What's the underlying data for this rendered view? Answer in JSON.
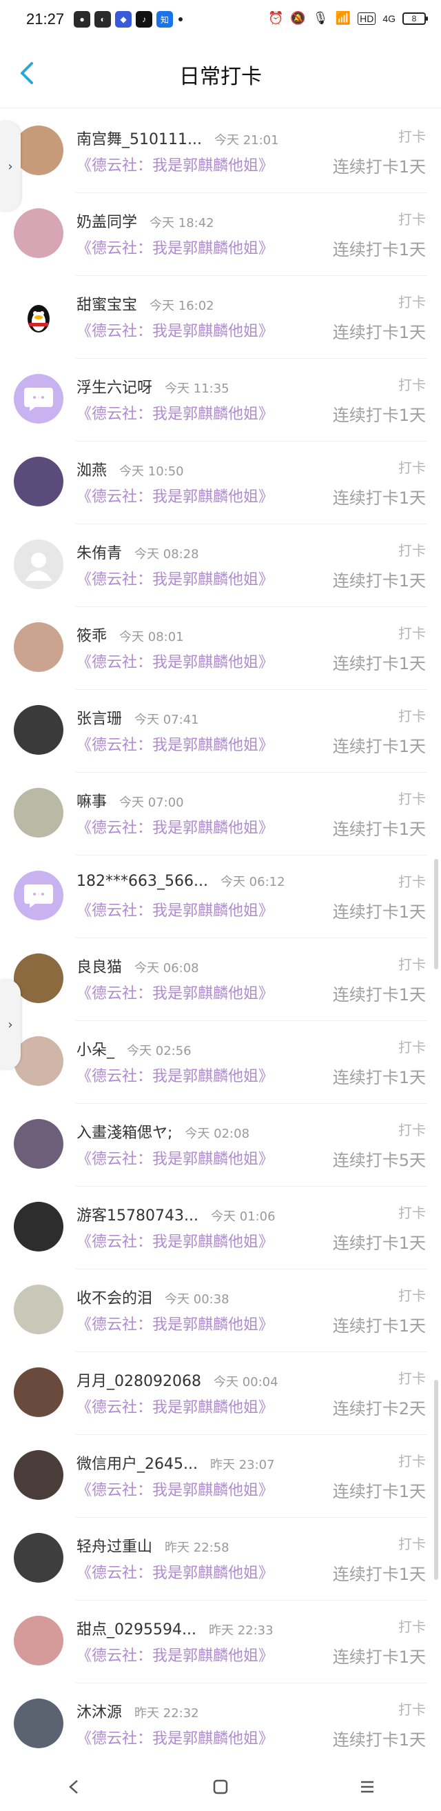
{
  "status_bar": {
    "time": "21:27",
    "battery": "8",
    "hd": "HD",
    "signal": "4G"
  },
  "header": {
    "title": "日常打卡"
  },
  "checkin_label": "打卡",
  "book": "《德云社：我是郭麒麟他姐》",
  "rows": [
    {
      "name": "南宫舞_510111...",
      "time": "今天 21:01",
      "streak": "连续打卡1天",
      "avatar": "anime-girl-avatar",
      "color": "#c79b7a"
    },
    {
      "name": "奶盖同学",
      "time": "今天 18:42",
      "streak": "连续打卡1天",
      "avatar": "anime-girl-avatar",
      "color": "#d7a6b5"
    },
    {
      "name": "甜蜜宝宝",
      "time": "今天 16:02",
      "streak": "连续打卡1天",
      "avatar": "penguin-avatar",
      "color": "#ffffff"
    },
    {
      "name": "浮生六记呀",
      "time": "今天 11:35",
      "streak": "连续打卡1天",
      "avatar": "default-chat-avatar",
      "color": "#c9b2f0"
    },
    {
      "name": "洳燕",
      "time": "今天 10:50",
      "streak": "连续打卡1天",
      "avatar": "night-scene-avatar",
      "color": "#5a4b7a"
    },
    {
      "name": "朱侑青",
      "time": "今天 08:28",
      "streak": "连续打卡1天",
      "avatar": "default-user-avatar",
      "color": "#e7e7e7"
    },
    {
      "name": "筱乖",
      "time": "今天 08:01",
      "streak": "连续打卡1天",
      "avatar": "photo-avatar",
      "color": "#caa48e"
    },
    {
      "name": "张言珊",
      "time": "今天 07:41",
      "streak": "连续打卡1天",
      "avatar": "photo-avatar",
      "color": "#3a3a3a"
    },
    {
      "name": "嘛事",
      "time": "今天 07:00",
      "streak": "连续打卡1天",
      "avatar": "cat-avatar",
      "color": "#b9b9a6"
    },
    {
      "name": "182***663_566...",
      "time": "今天 06:12",
      "streak": "连续打卡1天",
      "avatar": "default-chat-avatar",
      "color": "#c9b2f0"
    },
    {
      "name": "良良猫",
      "time": "今天 06:08",
      "streak": "连续打卡1天",
      "avatar": "photo-avatar",
      "color": "#8a6a3e"
    },
    {
      "name": "小朵_",
      "time": "今天 02:56",
      "streak": "连续打卡1天",
      "avatar": "photo-avatar",
      "color": "#d0b6a9"
    },
    {
      "name": "入畫淺箱偲ヤ;",
      "time": "今天 02:08",
      "streak": "连续打卡5天",
      "avatar": "photo-avatar",
      "color": "#6d5e7a"
    },
    {
      "name": "游客15780743...",
      "time": "今天 01:06",
      "streak": "连续打卡1天",
      "avatar": "photo-avatar",
      "color": "#2d2d2d"
    },
    {
      "name": "收不会的泪",
      "time": "今天 00:38",
      "streak": "连续打卡1天",
      "avatar": "photo-avatar",
      "color": "#c8c7b8"
    },
    {
      "name": "月月_028092068",
      "time": "今天 00:04",
      "streak": "连续打卡2天",
      "avatar": "photo-avatar",
      "color": "#6b4a3e"
    },
    {
      "name": "微信用户_2645...",
      "time": "昨天 23:07",
      "streak": "连续打卡1天",
      "avatar": "photo-avatar",
      "color": "#4a3d3a"
    },
    {
      "name": "轻舟过重山",
      "time": "昨天 22:58",
      "streak": "连续打卡1天",
      "avatar": "photo-avatar",
      "color": "#3e3e3e"
    },
    {
      "name": "甜点_0295594...",
      "time": "昨天 22:33",
      "streak": "连续打卡1天",
      "avatar": "photo-avatar",
      "color": "#d59a9a"
    },
    {
      "name": "沐沐源",
      "time": "昨天 22:32",
      "streak": "连续打卡1天",
      "avatar": "photo-avatar",
      "color": "#5b6270"
    }
  ]
}
